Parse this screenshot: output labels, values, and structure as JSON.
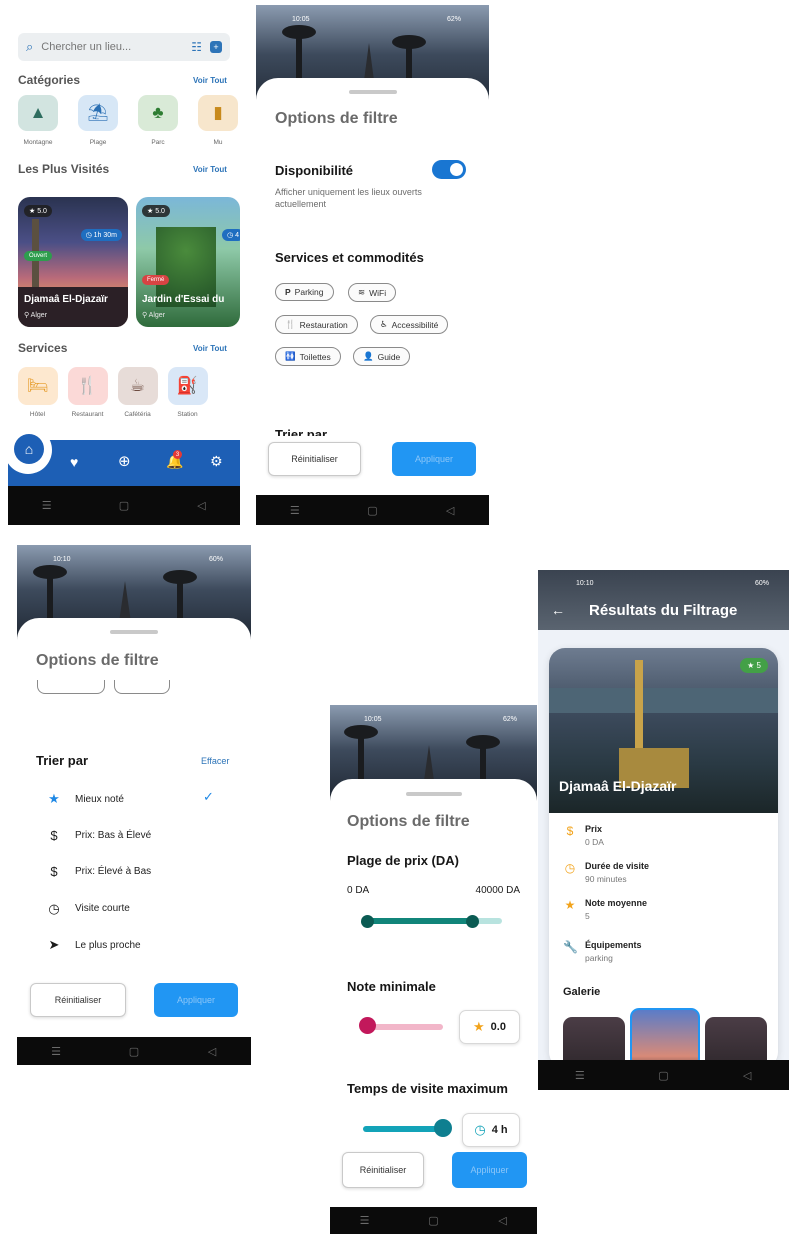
{
  "home": {
    "search_placeholder": "Chercher un lieu...",
    "categories_title": "Catégories",
    "voir_tout": "Voir Tout",
    "categories": [
      {
        "label": "Montagne",
        "icon": "▲",
        "bg": "#d2e4e0",
        "fg": "#2e6d5f"
      },
      {
        "label": "Plage",
        "icon": "⛱",
        "bg": "#d7e7f6",
        "fg": "#2a6fb3"
      },
      {
        "label": "Parc",
        "icon": "♣",
        "bg": "#d9ead7",
        "fg": "#2e7d32"
      },
      {
        "label": "Mu",
        "icon": "▮",
        "bg": "#f7e6cc",
        "fg": "#c88a1c"
      }
    ],
    "most_visited_title": "Les Plus Visités",
    "cards": [
      {
        "rating": "★ 5.0",
        "duration": "◷ 1h 30m",
        "status": "Ouvert",
        "name": "Djamaâ El-Djazaïr",
        "location": "⚲ Alger"
      },
      {
        "rating": "★ 5.0",
        "duration": "◷ 4",
        "status": "Fermé",
        "name": "Jardin d'Essai du",
        "location": "⚲ Alger"
      }
    ],
    "services_title": "Services",
    "services": [
      {
        "label": "Hôtel",
        "icon": "🛏",
        "bg": "#fde8cf",
        "fg": "#e59a26"
      },
      {
        "label": "Restaurant",
        "icon": "🍴",
        "bg": "#fbd9d7",
        "fg": "#c6443b"
      },
      {
        "label": "Cafétéria",
        "icon": "☕",
        "bg": "#e7dcd8",
        "fg": "#6d4c41"
      },
      {
        "label": "Station",
        "icon": "⛽",
        "bg": "#d9e7f7",
        "fg": "#1f6ec0"
      }
    ],
    "notification_count": "3"
  },
  "filter1": {
    "time": "10:05",
    "battery": "62%",
    "title": "Options de filtre",
    "availability_title": "Disponibilité",
    "availability_desc": "Afficher uniquement les lieux ouverts actuellement",
    "availability_on": true,
    "services_title": "Services et commodités",
    "chips": [
      {
        "icon": "P",
        "label": "Parking"
      },
      {
        "icon": "≋",
        "label": "WiFi"
      },
      {
        "icon": "🍴",
        "label": "Restauration"
      },
      {
        "icon": "♿",
        "label": "Accessibilité"
      },
      {
        "icon": "🚻",
        "label": "Toilettes"
      },
      {
        "icon": "👤",
        "label": "Guide"
      }
    ],
    "sort_title_partial": "Trier par",
    "reset": "Réinitialiser",
    "apply": "Appliquer"
  },
  "filter2": {
    "time": "10:10",
    "battery": "60%",
    "title": "Options de filtre",
    "sort_title": "Trier par",
    "clear": "Effacer",
    "sort_options": [
      {
        "icon": "★",
        "label": "Mieux noté",
        "selected": true
      },
      {
        "icon": "$",
        "label": "Prix: Bas à Élevé",
        "selected": false
      },
      {
        "icon": "$",
        "label": "Prix: Élevé à Bas",
        "selected": false
      },
      {
        "icon": "◷",
        "label": "Visite courte",
        "selected": false
      },
      {
        "icon": "➤",
        "label": "Le plus proche",
        "selected": false
      }
    ],
    "reset": "Réinitialiser",
    "apply": "Appliquer"
  },
  "filter3": {
    "time": "10:05",
    "battery": "62%",
    "title": "Options de filtre",
    "price_title": "Plage de prix (DA)",
    "price_min_label": "0 DA",
    "price_max_label": "40000 DA",
    "price_range_fraction": [
      0.0,
      0.78
    ],
    "rating_title": "Note minimale",
    "rating_value": "0.0",
    "duration_title": "Temps de visite maximum",
    "duration_value": "4 h",
    "reset": "Réinitialiser",
    "apply": "Appliquer"
  },
  "results": {
    "time": "10:10",
    "battery": "60%",
    "title": "Résultats du Filtrage",
    "rating_badge": "★ 5",
    "place_name": "Djamaâ El-Djazaïr",
    "info": [
      {
        "icon": "$",
        "label": "Prix",
        "value": "0 DA",
        "color": "#f2a31b"
      },
      {
        "icon": "◷",
        "label": "Durée de visite",
        "value": "90 minutes",
        "color": "#f2a31b"
      },
      {
        "icon": "★",
        "label": "Note moyenne",
        "value": "5",
        "color": "#f2a31b"
      },
      {
        "icon": "🔧",
        "label": "Équipements",
        "value": "parking",
        "color": "#f2a31b"
      }
    ],
    "gallery_title": "Galerie"
  },
  "colors": {
    "primary": "#1d5fb5",
    "apply_button": "#2196f3",
    "teal": "#11857a",
    "pink": "#c2185b",
    "cyan": "#13a3b8"
  }
}
